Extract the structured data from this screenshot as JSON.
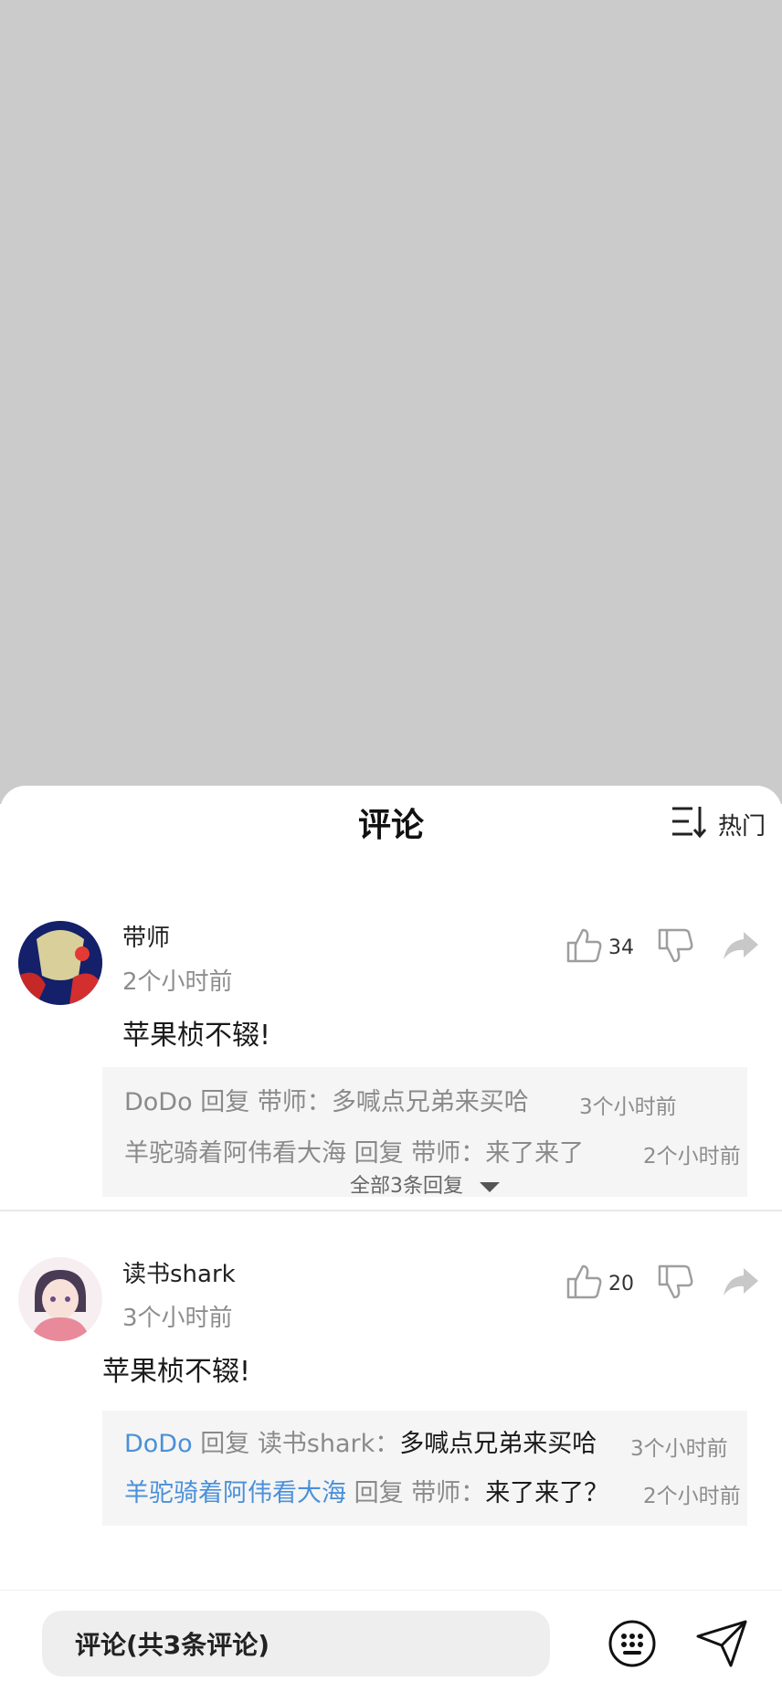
{
  "header": {
    "title": "评论",
    "sort_label": "热门"
  },
  "comments": [
    {
      "user": "带师",
      "time": "2个小时前",
      "text": "苹果桢不辍!",
      "likes": "34",
      "replies": [
        {
          "user": "DoDo",
          "verb": "回复",
          "target": "带师：",
          "text": "多喊点兄弟来买哈",
          "time": "3个小时前"
        },
        {
          "user": "羊驼骑着阿伟看大海",
          "verb": "回复",
          "target": "带师：",
          "text": "来了来了",
          "time": "2个小时前"
        }
      ],
      "more_label": "全部3条回复"
    },
    {
      "user": "读书shark",
      "time": "3个小时前",
      "text": "苹果桢不辍!",
      "likes": "20",
      "replies": [
        {
          "user": "DoDo",
          "verb": "回复",
          "target": "读书shark：",
          "text": "多喊点兄弟来买哈",
          "time": "3个小时前"
        },
        {
          "user": "羊驼骑着阿伟看大海",
          "verb": "回复",
          "target": "带师：",
          "text": "来了来了？",
          "time": "2个小时前"
        }
      ]
    }
  ],
  "footer": {
    "input_label": "评论(共3条评论)"
  },
  "colors": {
    "overlay": "#cbcbcb",
    "link_blue": "#4a90d9",
    "reply_bg": "#f5f5f5",
    "icon_gray": "#bdbdbd"
  }
}
